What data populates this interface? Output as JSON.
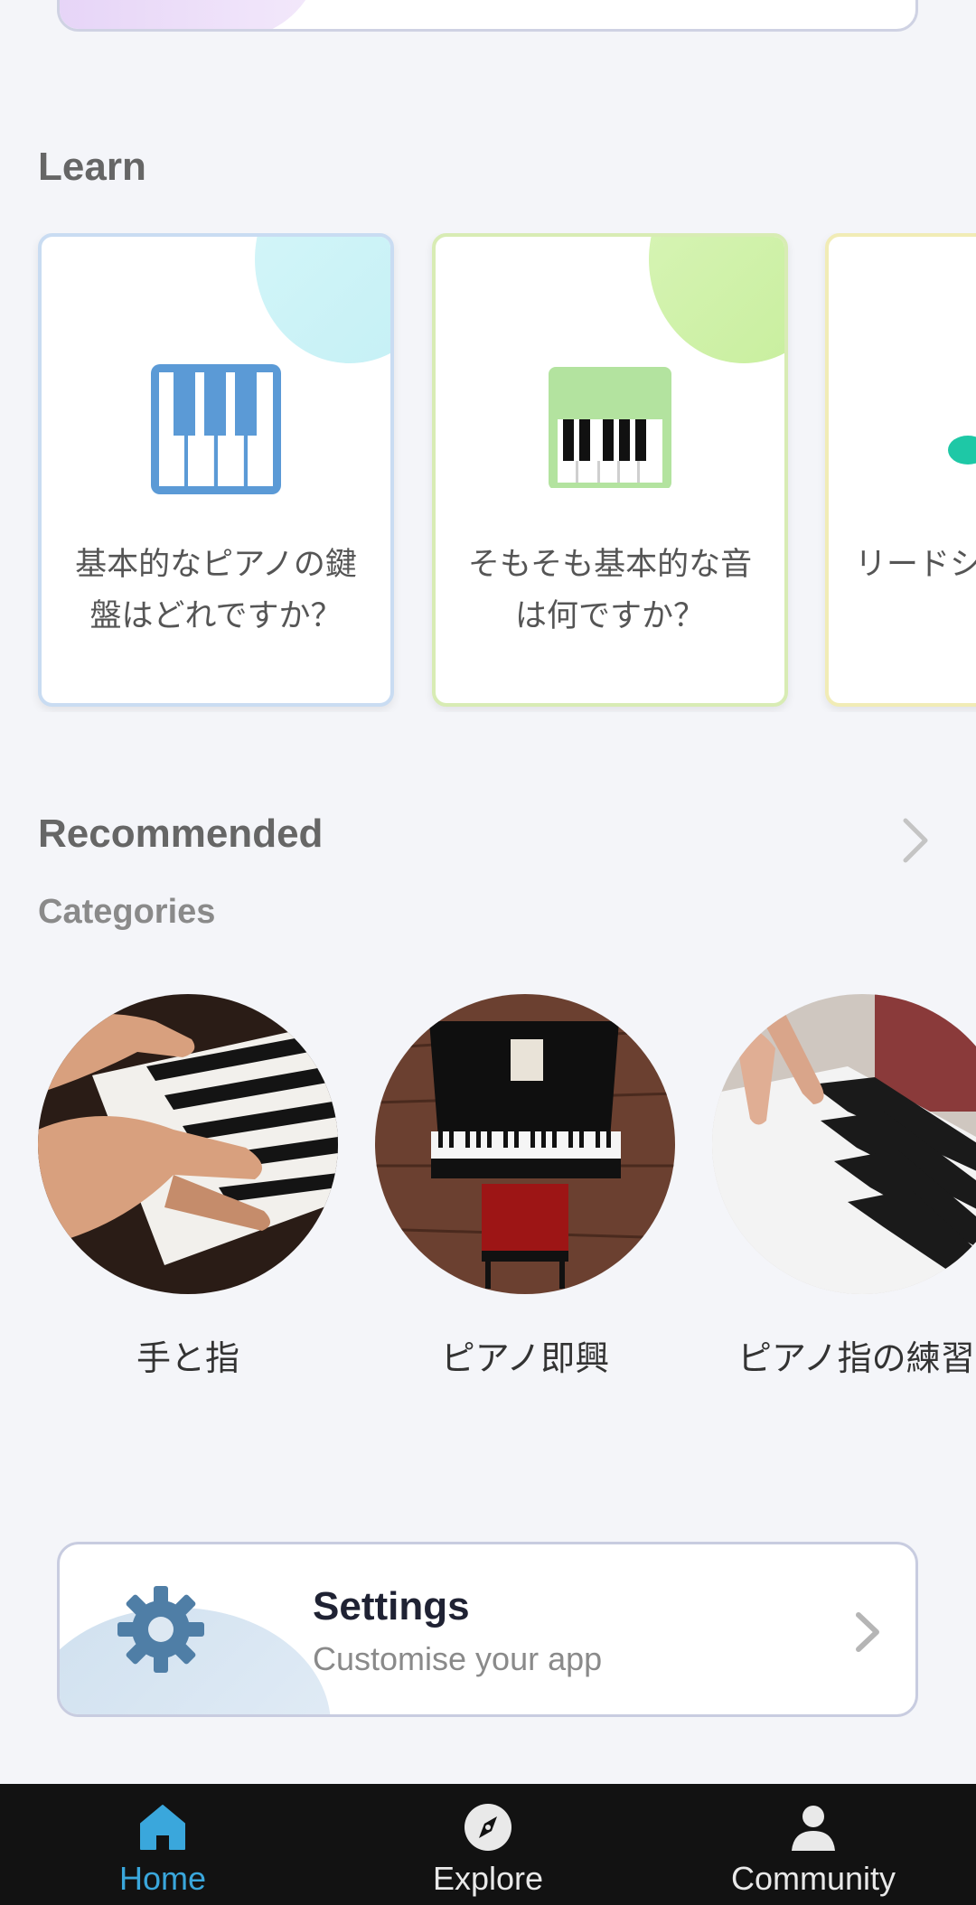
{
  "sections": {
    "learn": "Learn",
    "recommended": "Recommended",
    "categories": "Categories"
  },
  "learn_cards": [
    {
      "text": "基本的なピアノの鍵盤はどれですか？",
      "icon": "piano-keys-icon"
    },
    {
      "text": "そもそも基本的な音は何ですか？",
      "icon": "keyboard-icon"
    },
    {
      "text": "リードシートの楽記号",
      "icon": "music-note-icon"
    }
  ],
  "categories": [
    {
      "label": "手と指",
      "image": "hands-on-piano-photo"
    },
    {
      "label": "ピアノ即興",
      "image": "grand-piano-photo"
    },
    {
      "label": "ピアノ指の練習",
      "image": "finger-on-keys-photo"
    }
  ],
  "settings": {
    "title": "Settings",
    "subtitle": "Customise your app"
  },
  "tabs": [
    {
      "label": "Home",
      "icon": "home-icon",
      "active": true
    },
    {
      "label": "Explore",
      "icon": "compass-icon",
      "active": false
    },
    {
      "label": "Community",
      "icon": "person-icon",
      "active": false
    }
  ],
  "colors": {
    "background": "#f4f5f9",
    "tab_bar": "#121212",
    "active_tab": "#3aa7dc"
  }
}
